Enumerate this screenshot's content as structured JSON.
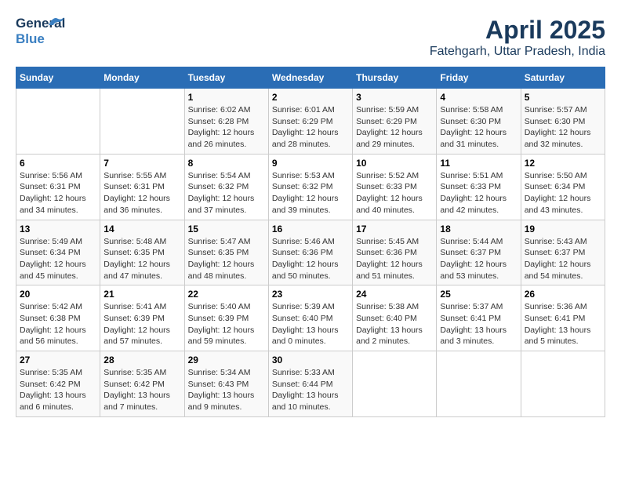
{
  "header": {
    "logo_line1": "General",
    "logo_line2": "Blue",
    "title": "April 2025",
    "subtitle": "Fatehgarh, Uttar Pradesh, India"
  },
  "weekdays": [
    "Sunday",
    "Monday",
    "Tuesday",
    "Wednesday",
    "Thursday",
    "Friday",
    "Saturday"
  ],
  "weeks": [
    [
      {
        "day": "",
        "info": ""
      },
      {
        "day": "",
        "info": ""
      },
      {
        "day": "1",
        "info": "Sunrise: 6:02 AM\nSunset: 6:28 PM\nDaylight: 12 hours and 26 minutes."
      },
      {
        "day": "2",
        "info": "Sunrise: 6:01 AM\nSunset: 6:29 PM\nDaylight: 12 hours and 28 minutes."
      },
      {
        "day": "3",
        "info": "Sunrise: 5:59 AM\nSunset: 6:29 PM\nDaylight: 12 hours and 29 minutes."
      },
      {
        "day": "4",
        "info": "Sunrise: 5:58 AM\nSunset: 6:30 PM\nDaylight: 12 hours and 31 minutes."
      },
      {
        "day": "5",
        "info": "Sunrise: 5:57 AM\nSunset: 6:30 PM\nDaylight: 12 hours and 32 minutes."
      }
    ],
    [
      {
        "day": "6",
        "info": "Sunrise: 5:56 AM\nSunset: 6:31 PM\nDaylight: 12 hours and 34 minutes."
      },
      {
        "day": "7",
        "info": "Sunrise: 5:55 AM\nSunset: 6:31 PM\nDaylight: 12 hours and 36 minutes."
      },
      {
        "day": "8",
        "info": "Sunrise: 5:54 AM\nSunset: 6:32 PM\nDaylight: 12 hours and 37 minutes."
      },
      {
        "day": "9",
        "info": "Sunrise: 5:53 AM\nSunset: 6:32 PM\nDaylight: 12 hours and 39 minutes."
      },
      {
        "day": "10",
        "info": "Sunrise: 5:52 AM\nSunset: 6:33 PM\nDaylight: 12 hours and 40 minutes."
      },
      {
        "day": "11",
        "info": "Sunrise: 5:51 AM\nSunset: 6:33 PM\nDaylight: 12 hours and 42 minutes."
      },
      {
        "day": "12",
        "info": "Sunrise: 5:50 AM\nSunset: 6:34 PM\nDaylight: 12 hours and 43 minutes."
      }
    ],
    [
      {
        "day": "13",
        "info": "Sunrise: 5:49 AM\nSunset: 6:34 PM\nDaylight: 12 hours and 45 minutes."
      },
      {
        "day": "14",
        "info": "Sunrise: 5:48 AM\nSunset: 6:35 PM\nDaylight: 12 hours and 47 minutes."
      },
      {
        "day": "15",
        "info": "Sunrise: 5:47 AM\nSunset: 6:35 PM\nDaylight: 12 hours and 48 minutes."
      },
      {
        "day": "16",
        "info": "Sunrise: 5:46 AM\nSunset: 6:36 PM\nDaylight: 12 hours and 50 minutes."
      },
      {
        "day": "17",
        "info": "Sunrise: 5:45 AM\nSunset: 6:36 PM\nDaylight: 12 hours and 51 minutes."
      },
      {
        "day": "18",
        "info": "Sunrise: 5:44 AM\nSunset: 6:37 PM\nDaylight: 12 hours and 53 minutes."
      },
      {
        "day": "19",
        "info": "Sunrise: 5:43 AM\nSunset: 6:37 PM\nDaylight: 12 hours and 54 minutes."
      }
    ],
    [
      {
        "day": "20",
        "info": "Sunrise: 5:42 AM\nSunset: 6:38 PM\nDaylight: 12 hours and 56 minutes."
      },
      {
        "day": "21",
        "info": "Sunrise: 5:41 AM\nSunset: 6:39 PM\nDaylight: 12 hours and 57 minutes."
      },
      {
        "day": "22",
        "info": "Sunrise: 5:40 AM\nSunset: 6:39 PM\nDaylight: 12 hours and 59 minutes."
      },
      {
        "day": "23",
        "info": "Sunrise: 5:39 AM\nSunset: 6:40 PM\nDaylight: 13 hours and 0 minutes."
      },
      {
        "day": "24",
        "info": "Sunrise: 5:38 AM\nSunset: 6:40 PM\nDaylight: 13 hours and 2 minutes."
      },
      {
        "day": "25",
        "info": "Sunrise: 5:37 AM\nSunset: 6:41 PM\nDaylight: 13 hours and 3 minutes."
      },
      {
        "day": "26",
        "info": "Sunrise: 5:36 AM\nSunset: 6:41 PM\nDaylight: 13 hours and 5 minutes."
      }
    ],
    [
      {
        "day": "27",
        "info": "Sunrise: 5:35 AM\nSunset: 6:42 PM\nDaylight: 13 hours and 6 minutes."
      },
      {
        "day": "28",
        "info": "Sunrise: 5:35 AM\nSunset: 6:42 PM\nDaylight: 13 hours and 7 minutes."
      },
      {
        "day": "29",
        "info": "Sunrise: 5:34 AM\nSunset: 6:43 PM\nDaylight: 13 hours and 9 minutes."
      },
      {
        "day": "30",
        "info": "Sunrise: 5:33 AM\nSunset: 6:44 PM\nDaylight: 13 hours and 10 minutes."
      },
      {
        "day": "",
        "info": ""
      },
      {
        "day": "",
        "info": ""
      },
      {
        "day": "",
        "info": ""
      }
    ]
  ]
}
